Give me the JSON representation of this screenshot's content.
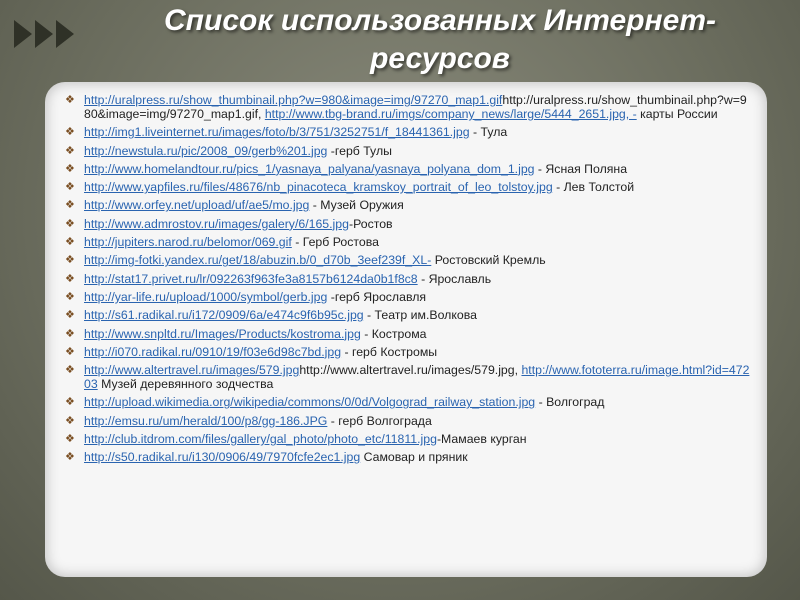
{
  "slide": {
    "title": "Список использованных Интернет-ресурсов",
    "bullet_icon": "diamond-bullet-icon",
    "colors": {
      "link": "#2a64b0",
      "title": "#ffffff",
      "background": "#6b6d5e",
      "bullet": "#7a4e22"
    }
  },
  "references": [
    {
      "link": "http://uralpress.ru/show_thumbinail.php?w=980&image=img/97270_map1.gif",
      "text": "http://uralpress.ru/show_thumbinail.php?w=980&image=img/97270_map1.gif,",
      "link2": "http://www.tbg-brand.ru/imgs/company_news/large/5444_2651.jpg, -",
      "text2": " карты России"
    },
    {
      "link": "http://img1.liveinternet.ru/images/foto/b/3/751/3252751/f_18441361.jpg",
      "text": " - Тула"
    },
    {
      "link": "http://newstula.ru/pic/2008_09/gerb%201.jpg",
      "text": "  -герб Тулы"
    },
    {
      "link": "http://www.homelandtour.ru/pics_1/yasnaya_palyana/yasnaya_polyana_dom_1.jpg",
      "text": " - Ясная Поляна"
    },
    {
      "link": "http://www.yapfiles.ru/files/48676/nb_pinacoteca_kramskoy_portrait_of_leo_tolstoy.jpg",
      "text": " - Лев Толстой"
    },
    {
      "link": "http://www.orfey.net/upload/uf/ae5/mo.jpg",
      "text": " - Музей Оружия"
    },
    {
      "link": "http://www.admrostov.ru/images/galery/6/165.jpg",
      "text": "-Ростов"
    },
    {
      "link": "http://jupiters.narod.ru/belomor/069.gif",
      "text": " - Герб Ростова"
    },
    {
      "link": "http://img-fotki.yandex.ru/get/18/abuzin.b/0_d70b_3eef239f_XL-",
      "text": " Ростовский Кремль"
    },
    {
      "link": "http://stat17.privet.ru/lr/092263f963fe3a8157b6124da0b1f8c8",
      "text": " - Ярославль"
    },
    {
      "link": "http://yar-life.ru/upload/1000/symbol/gerb.jpg",
      "text": " -герб Ярославля"
    },
    {
      "link": "http://s61.radikal.ru/i172/0909/6a/e474c9f6b95c.jpg",
      "text": " - Театр им.Волкова"
    },
    {
      "link": "http://www.snpltd.ru/Images/Products/kostroma.jpg",
      "text": " - Кострома"
    },
    {
      "link": "http://i070.radikal.ru/0910/19/f03e6d98c7bd.jpg",
      "text": " - герб Костромы"
    },
    {
      "link": "http://www.altertravel.ru/images/579.jpg",
      "text": "http://www.altertravel.ru/images/579.jpg,",
      "link2": "http://www.fototerra.ru/image.html?id=47203",
      "text2": " Музей деревянного зодчества"
    },
    {
      "link": "http://upload.wikimedia.org/wikipedia/commons/0/0d/Volgograd_railway_station.jpg",
      "text": " - Волгоград"
    },
    {
      "link": "http://emsu.ru/um/herald/100/p8/gg-186.JPG",
      "text": " - герб Волгограда"
    },
    {
      "link": "http://club.itdrom.com/files/gallery/gal_photo/photo_etc/11811.jpg",
      "text": "-Мамаев курган"
    },
    {
      "link": "http://s50.radikal.ru/i130/0906/49/7970fcfe2ec1.jpg",
      "text": " Самовар и пряник"
    }
  ]
}
